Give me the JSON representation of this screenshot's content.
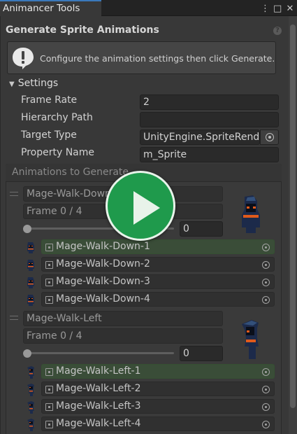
{
  "window": {
    "tab_title": "Animancer Tools"
  },
  "tab_icons": [
    "kebab-menu-icon",
    "maximize-icon",
    "close-icon"
  ],
  "header": {
    "title": "Generate Sprite Animations"
  },
  "helpbox": {
    "message": "Configure the animation settings then click Generate."
  },
  "settings": {
    "foldout_label": "Settings",
    "frame_rate_label": "Frame Rate",
    "frame_rate_value": "2",
    "hierarchy_path_label": "Hierarchy Path",
    "hierarchy_path_value": "",
    "target_type_label": "Target Type",
    "target_type_value": "UnityEngine.SpriteRenderer",
    "property_name_label": "Property Name",
    "property_name_value": "m_Sprite"
  },
  "animations": {
    "header": "Animations to Generate",
    "items": [
      {
        "name": "Mage-Walk-Down",
        "frame_label": "Frame 0 / 4",
        "slider_value": "0",
        "sprites": [
          "Mage-Walk-Down-1",
          "Mage-Walk-Down-2",
          "Mage-Walk-Down-3",
          "Mage-Walk-Down-4"
        ]
      },
      {
        "name": "Mage-Walk-Left",
        "frame_label": "Frame 0 / 4",
        "slider_value": "0",
        "sprites": [
          "Mage-Walk-Left-1",
          "Mage-Walk-Left-2",
          "Mage-Walk-Left-3",
          "Mage-Walk-Left-4"
        ]
      }
    ]
  },
  "colors": {
    "background": "#383838",
    "active_row": "#3a4d38",
    "play_button": "#1f9a4c",
    "tab_accent": "#3a79bb"
  }
}
